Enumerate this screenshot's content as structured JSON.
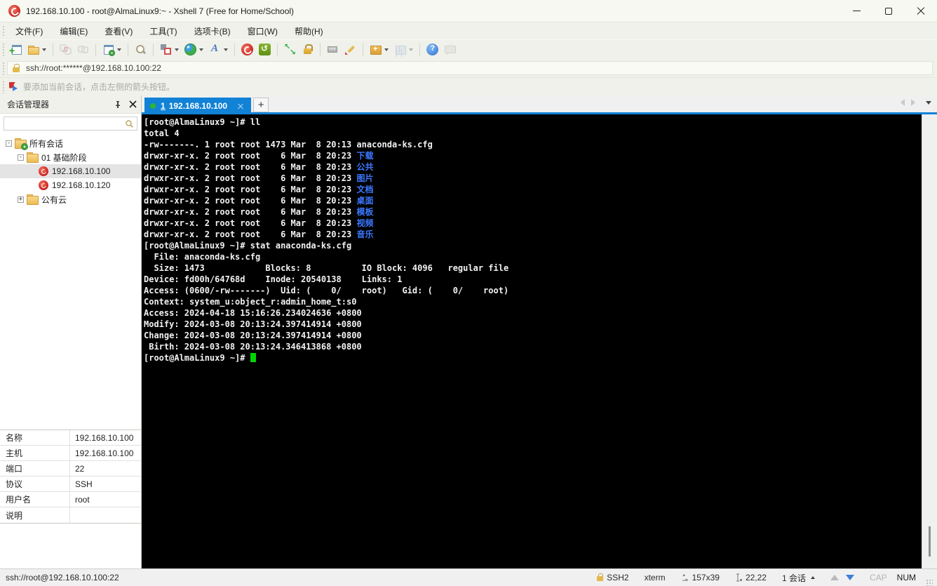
{
  "colors": {
    "accent": "#1182d6",
    "terminal_blue": "#3b78ff",
    "cursor_green": "#00d400",
    "folder_yellow": "#f3c96f"
  },
  "window": {
    "title": "192.168.10.100 - root@AlmaLinux9:~ - Xshell 7 (Free for Home/School)"
  },
  "menu": {
    "items": [
      "文件(F)",
      "编辑(E)",
      "查看(V)",
      "工具(T)",
      "选项卡(B)",
      "窗口(W)",
      "帮助(H)"
    ]
  },
  "toolbar": {
    "items": [
      {
        "name": "new-session-icon",
        "kind": "new-session"
      },
      {
        "name": "open-session-icon",
        "kind": "open",
        "dropdown": true
      },
      {
        "sep": true
      },
      {
        "name": "disconnect-icon",
        "kind": "disconnect",
        "disabled": true
      },
      {
        "name": "reconnect-icon",
        "kind": "reconnect",
        "disabled": true
      },
      {
        "sep": true
      },
      {
        "name": "session-properties-icon",
        "kind": "properties",
        "dropdown": true
      },
      {
        "sep": true
      },
      {
        "name": "find-icon",
        "kind": "search"
      },
      {
        "sep": true
      },
      {
        "name": "compose-pane-icon",
        "kind": "compose",
        "dropdown": true
      },
      {
        "name": "encoding-globe-icon",
        "kind": "globe",
        "dropdown": true
      },
      {
        "name": "font-icon",
        "kind": "font",
        "dropdown": true
      },
      {
        "sep": true
      },
      {
        "name": "xshell-icon",
        "kind": "xshell"
      },
      {
        "name": "xftp-icon",
        "kind": "xftp"
      },
      {
        "sep": true
      },
      {
        "name": "fullscreen-icon",
        "kind": "fullscreen"
      },
      {
        "name": "lock-screen-icon",
        "kind": "lock"
      },
      {
        "sep": true
      },
      {
        "name": "virtual-keyboard-icon",
        "kind": "keyboard"
      },
      {
        "name": "highlight-pen-icon",
        "kind": "pen"
      },
      {
        "sep": true
      },
      {
        "name": "new-folder-icon",
        "kind": "new-folder",
        "dropdown": true
      },
      {
        "name": "tile-layout-icon",
        "kind": "tile",
        "dropdown": true,
        "disabled": true
      },
      {
        "sep": true
      },
      {
        "name": "help-icon",
        "kind": "help"
      },
      {
        "name": "message-icon",
        "kind": "message",
        "disabled": true
      }
    ]
  },
  "address_bar": {
    "value": "ssh://root:******@192.168.10.100:22"
  },
  "info_bar": {
    "text": "要添加当前会话，点击左侧的箭头按钮。"
  },
  "session_manager": {
    "title": "会话管理器",
    "search_placeholder": "",
    "expander_glyphs": {
      "minus": "-",
      "plus": "+"
    },
    "tree": [
      {
        "id": "all-sessions",
        "label": "所有会话",
        "icon": "folder-gear",
        "expander": "minus",
        "level": 0
      },
      {
        "id": "folder-01-basic",
        "label": "01 基础阶段",
        "icon": "folder",
        "expander": "minus",
        "level": 1
      },
      {
        "id": "session-192-168-10-100",
        "label": "192.168.10.100",
        "icon": "session",
        "level": 2,
        "selected": true
      },
      {
        "id": "session-192-168-10-120",
        "label": "192.168.10.120",
        "icon": "session",
        "level": 2
      },
      {
        "id": "folder-public-cloud",
        "label": "公有云",
        "icon": "folder",
        "expander": "plus",
        "level": 1
      }
    ]
  },
  "tabbar": {
    "tab": {
      "index": "1",
      "label": "192.168.10.100"
    },
    "new_tab_label": "+"
  },
  "terminal": {
    "cursor_visible": true,
    "lines": [
      [
        {
          "t": "[root@AlmaLinux9 ~]# ll",
          "c": "w"
        }
      ],
      [
        {
          "t": "total 4",
          "c": "w"
        }
      ],
      [
        {
          "t": "-rw-------. 1 root root 1473 Mar  8 20:13 anaconda-ks.cfg",
          "c": "w"
        }
      ],
      [
        {
          "t": "drwxr-xr-x. 2 root root    6 Mar  8 20:23 ",
          "c": "w"
        },
        {
          "t": "下载",
          "c": "b"
        }
      ],
      [
        {
          "t": "drwxr-xr-x. 2 root root    6 Mar  8 20:23 ",
          "c": "w"
        },
        {
          "t": "公共",
          "c": "b"
        }
      ],
      [
        {
          "t": "drwxr-xr-x. 2 root root    6 Mar  8 20:23 ",
          "c": "w"
        },
        {
          "t": "图片",
          "c": "b"
        }
      ],
      [
        {
          "t": "drwxr-xr-x. 2 root root    6 Mar  8 20:23 ",
          "c": "w"
        },
        {
          "t": "文档",
          "c": "b"
        }
      ],
      [
        {
          "t": "drwxr-xr-x. 2 root root    6 Mar  8 20:23 ",
          "c": "w"
        },
        {
          "t": "桌面",
          "c": "b"
        }
      ],
      [
        {
          "t": "drwxr-xr-x. 2 root root    6 Mar  8 20:23 ",
          "c": "w"
        },
        {
          "t": "模板",
          "c": "b"
        }
      ],
      [
        {
          "t": "drwxr-xr-x. 2 root root    6 Mar  8 20:23 ",
          "c": "w"
        },
        {
          "t": "视频",
          "c": "b"
        }
      ],
      [
        {
          "t": "drwxr-xr-x. 2 root root    6 Mar  8 20:23 ",
          "c": "w"
        },
        {
          "t": "音乐",
          "c": "b"
        }
      ],
      [
        {
          "t": "[root@AlmaLinux9 ~]# stat anaconda-ks.cfg",
          "c": "w"
        }
      ],
      [
        {
          "t": "  File: anaconda-ks.cfg",
          "c": "w"
        }
      ],
      [
        {
          "t": "  Size: 1473            Blocks: 8          IO Block: 4096   regular file",
          "c": "w"
        }
      ],
      [
        {
          "t": "Device: fd00h/64768d    Inode: 20540138    Links: 1",
          "c": "w"
        }
      ],
      [
        {
          "t": "Access: (0600/-rw-------)  Uid: (    0/    root)   Gid: (    0/    root)",
          "c": "w"
        }
      ],
      [
        {
          "t": "Context: system_u:object_r:admin_home_t:s0",
          "c": "w"
        }
      ],
      [
        {
          "t": "Access: 2024-04-18 15:16:26.234024636 +0800",
          "c": "w"
        }
      ],
      [
        {
          "t": "Modify: 2024-03-08 20:13:24.397414914 +0800",
          "c": "w"
        }
      ],
      [
        {
          "t": "Change: 2024-03-08 20:13:24.397414914 +0800",
          "c": "w"
        }
      ],
      [
        {
          "t": " Birth: 2024-03-08 20:13:24.346413868 +0800",
          "c": "w"
        }
      ],
      [
        {
          "t": "[root@AlmaLinux9 ~]# ",
          "c": "w"
        }
      ]
    ]
  },
  "properties": {
    "rows": [
      {
        "label": "名称",
        "value": "192.168.10.100"
      },
      {
        "label": "主机",
        "value": "192.168.10.100"
      },
      {
        "label": "端口",
        "value": "22"
      },
      {
        "label": "协议",
        "value": "SSH"
      },
      {
        "label": "用户名",
        "value": "root"
      },
      {
        "label": "说明",
        "value": ""
      }
    ]
  },
  "status_bar": {
    "left": "ssh://root@192.168.10.100:22",
    "encryption": "SSH2",
    "term_type": "xterm",
    "size": "157x39",
    "cursor_pos": "22,22",
    "session_count": "1 会话",
    "cap": "CAP",
    "num": "NUM"
  }
}
